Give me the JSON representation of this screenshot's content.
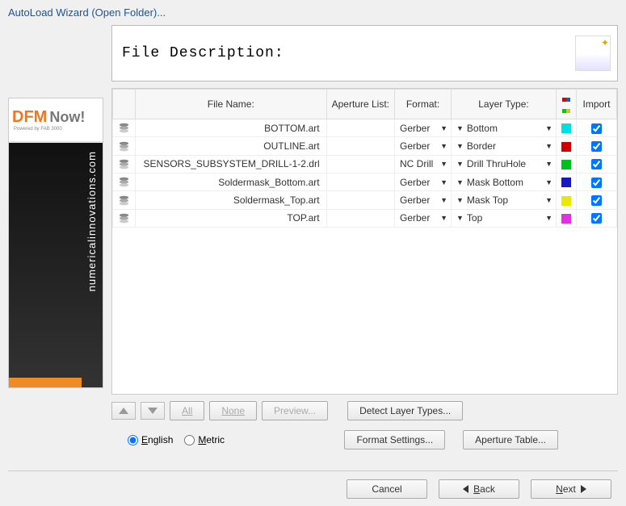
{
  "window": {
    "title": "AutoLoad Wizard (Open Folder)..."
  },
  "sidebar": {
    "brand_bold": "DFM",
    "brand_reg": "Now!",
    "brand_sub": "Powered by FAB 3000",
    "url": "numericalinnovations.com"
  },
  "desc": {
    "label": "File Description:"
  },
  "columns": {
    "icon": "",
    "fname": "File Name:",
    "aperture": "Aperture List:",
    "format": "Format:",
    "layer": "Layer Type:",
    "color": "",
    "import": "Import"
  },
  "rows": [
    {
      "fname": "BOTTOM.art",
      "format": "Gerber",
      "layer": "Bottom",
      "color": "#00e0e0",
      "import": true
    },
    {
      "fname": "OUTLINE.art",
      "format": "Gerber",
      "layer": "Border",
      "color": "#d00000",
      "import": true
    },
    {
      "fname": "SENSORS_SUBSYSTEM_DRILL-1-2.drl",
      "format": "NC Drill",
      "layer": "Drill ThruHole",
      "color": "#00c020",
      "import": true
    },
    {
      "fname": "Soldermask_Bottom.art",
      "format": "Gerber",
      "layer": "Mask Bottom",
      "color": "#1818c0",
      "import": true
    },
    {
      "fname": "Soldermask_Top.art",
      "format": "Gerber",
      "layer": "Mask Top",
      "color": "#e8e800",
      "import": true
    },
    {
      "fname": "TOP.art",
      "format": "Gerber",
      "layer": "Top",
      "color": "#e030e0",
      "import": true
    }
  ],
  "toolbar": {
    "all": "All",
    "none": "None",
    "preview": "Preview...",
    "detect": "Detect Layer Types..."
  },
  "units": {
    "english": "English",
    "metric": "Metric",
    "selected": "english"
  },
  "settings": {
    "format": "Format Settings...",
    "aperture": "Aperture Table..."
  },
  "footer": {
    "cancel": "Cancel",
    "back": "Back",
    "next": "Next"
  }
}
